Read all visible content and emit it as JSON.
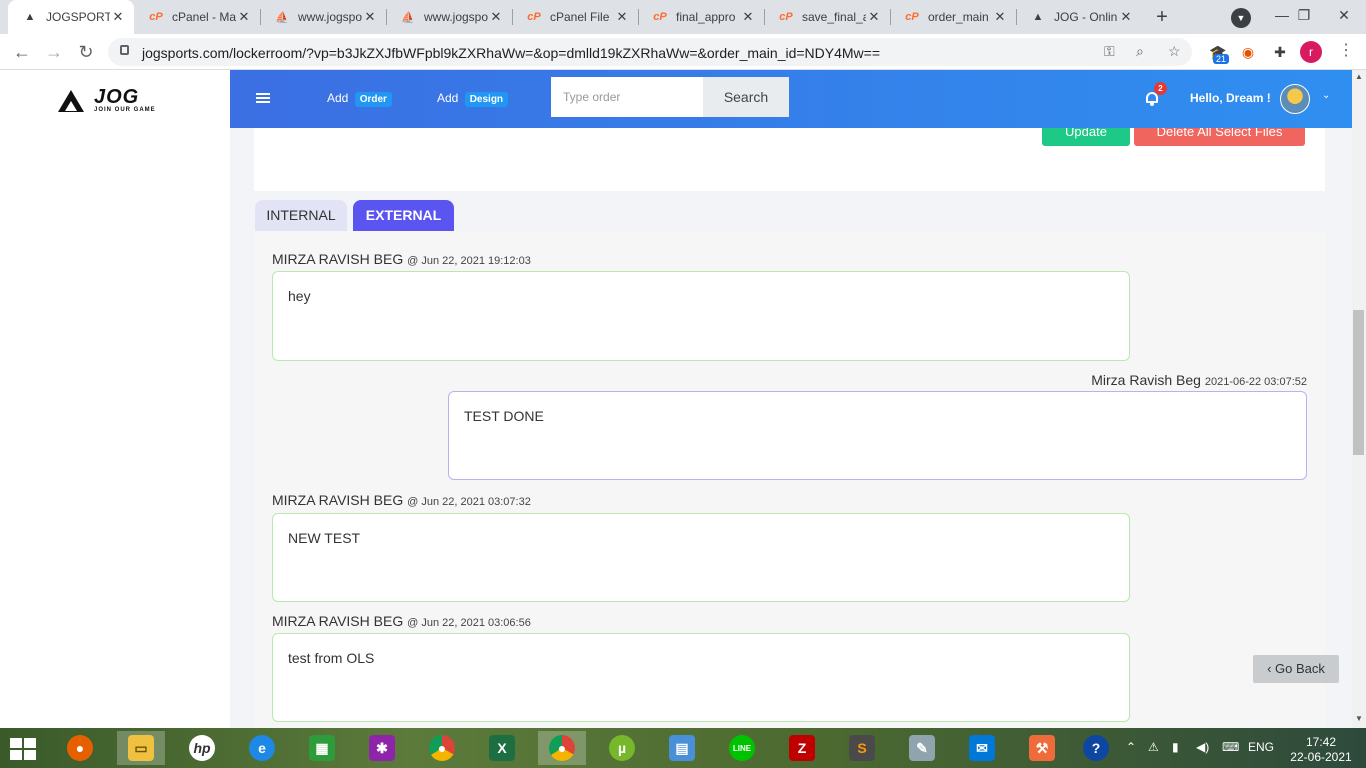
{
  "browser": {
    "tabs": [
      {
        "title": "JOGSPORTS",
        "icon": "jog-logo-icon",
        "active": true
      },
      {
        "title": "cPanel - Ma",
        "icon": "cpanel-icon"
      },
      {
        "title": "www.jogspo",
        "icon": "pma-icon"
      },
      {
        "title": "www.jogspo",
        "icon": "pma-icon"
      },
      {
        "title": "cPanel File",
        "icon": "cpanel-icon"
      },
      {
        "title": "final_appro",
        "icon": "cpanel-icon"
      },
      {
        "title": "save_final_a",
        "icon": "cpanel-icon"
      },
      {
        "title": "order_main",
        "icon": "cpanel-icon"
      },
      {
        "title": "JOG - Onlin",
        "icon": "jog-logo-icon"
      }
    ],
    "url": "jogsports.com/lockerroom/?vp=b3JkZXJfbWFpbl9kZXRhaWw=&op=dmlld19kZXRhaWw=&order_main_id=NDY4Mw==",
    "extension_badge": "21",
    "profile_initial": "r"
  },
  "logo": {
    "word": "JOG",
    "tagline": "JOIN OUR GAME"
  },
  "header": {
    "add_order_label": "Add",
    "add_order_pill": "Order",
    "add_design_label": "Add",
    "add_design_pill": "Design",
    "search_placeholder": "Type order",
    "search_button": "Search",
    "notification_count": "2",
    "greeting": "Hello, Dream !"
  },
  "actions": {
    "update_label": "Update",
    "delete_label": "Delete All Select Files"
  },
  "chat_tabs": {
    "internal": "INTERNAL",
    "external": "EXTERNAL"
  },
  "messages": [
    {
      "author": "MIRZA RAVISH BEG",
      "timestamp": "@ Jun 22, 2021 19:12:03",
      "text": "hey",
      "side": "left"
    },
    {
      "author": "Mirza Ravish Beg",
      "timestamp": "2021-06-22 03:07:52",
      "text": "TEST DONE",
      "side": "right"
    },
    {
      "author": "MIRZA RAVISH BEG",
      "timestamp": "@ Jun 22, 2021 03:07:32",
      "text": "NEW TEST",
      "side": "left"
    },
    {
      "author": "MIRZA RAVISH BEG",
      "timestamp": "@ Jun 22, 2021 03:06:56",
      "text": "test from OLS",
      "side": "left"
    }
  ],
  "go_back_label": "‹ Go Back",
  "taskbar": {
    "language": "ENG",
    "time": "17:42",
    "date": "22-06-2021"
  }
}
